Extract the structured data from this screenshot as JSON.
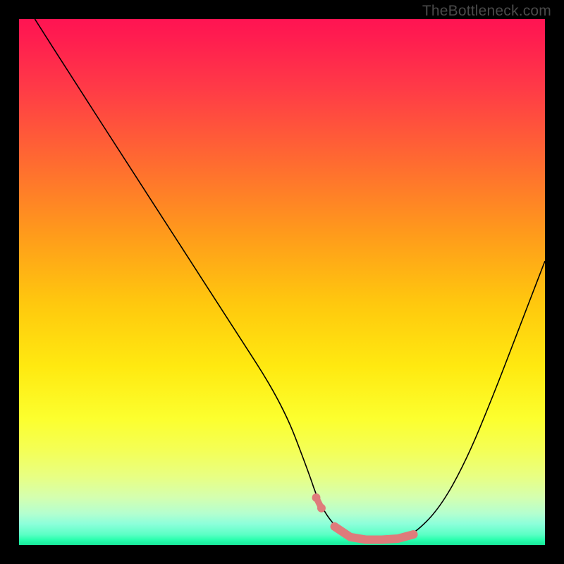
{
  "watermark": "TheBottleneck.com",
  "chart_data": {
    "type": "line",
    "title": "",
    "xlabel": "",
    "ylabel": "",
    "xlim": [
      0,
      100
    ],
    "ylim": [
      0,
      100
    ],
    "series": [
      {
        "name": "curve",
        "x": [
          3,
          10,
          20,
          30,
          40,
          50,
          55,
          57,
          60,
          63,
          66,
          69,
          72,
          75,
          80,
          85,
          90,
          95,
          100
        ],
        "values": [
          100,
          89,
          73.5,
          58,
          42.5,
          27,
          14,
          8,
          3.5,
          1.5,
          1,
          1,
          1.2,
          2,
          7,
          16,
          28,
          41,
          54
        ]
      }
    ],
    "highlight": {
      "color": "#df7b7b",
      "segments": [
        {
          "x": [
            56.5,
            57.5
          ],
          "values": [
            9,
            7
          ]
        },
        {
          "x": [
            60,
            63,
            66,
            69,
            72,
            75
          ],
          "values": [
            3.5,
            1.5,
            1,
            1,
            1.2,
            2
          ]
        }
      ]
    },
    "background_gradient": {
      "stops": [
        {
          "pos": 0,
          "color": "#ff1452"
        },
        {
          "pos": 50,
          "color": "#ffd600"
        },
        {
          "pos": 80,
          "color": "#f2ff50"
        },
        {
          "pos": 100,
          "color": "#18e89a"
        }
      ]
    }
  }
}
